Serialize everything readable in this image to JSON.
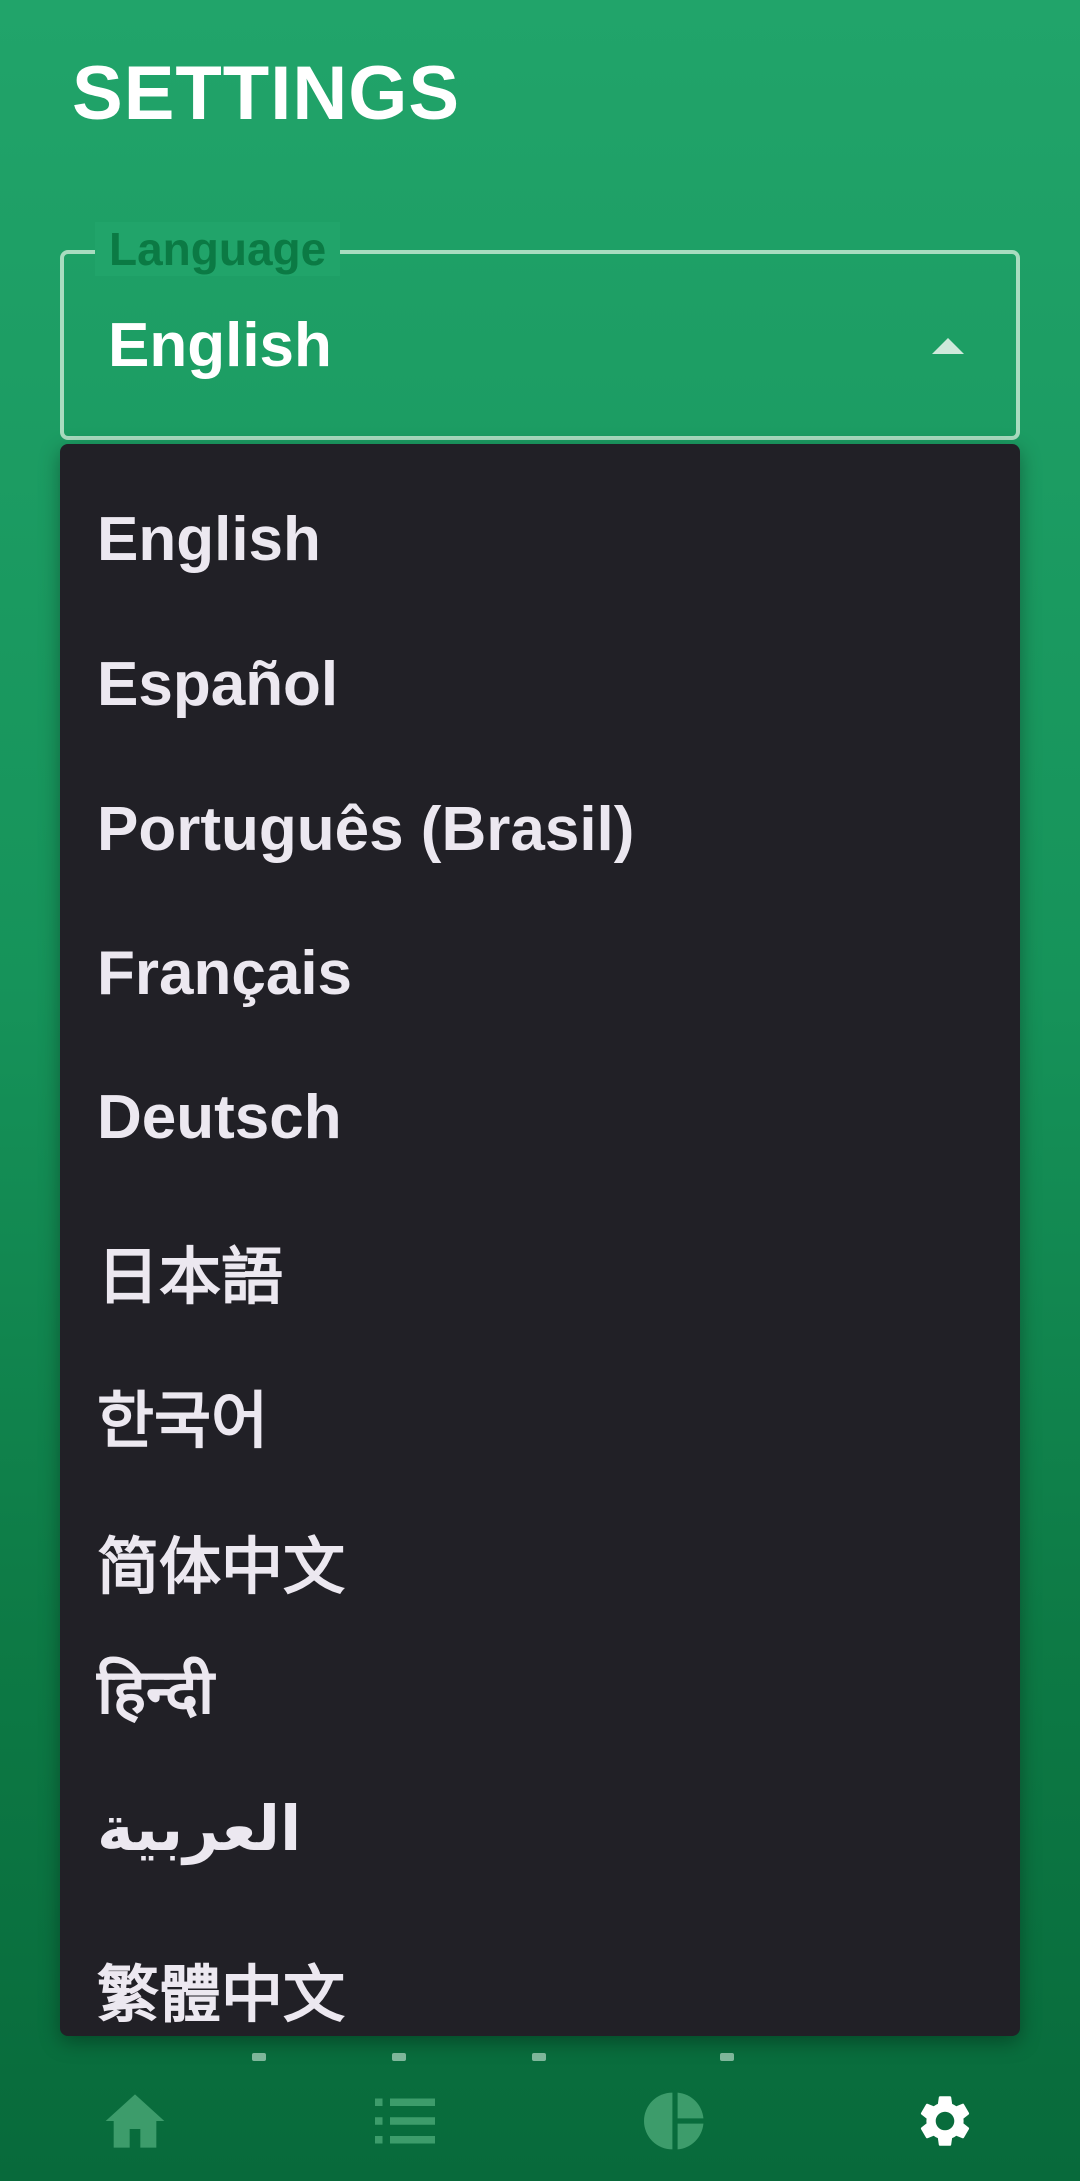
{
  "header": {
    "title": "SETTINGS"
  },
  "language_field": {
    "label": "Language",
    "selected": "English"
  },
  "dropdown": {
    "options": [
      "English",
      "Español",
      "Português (Brasil)",
      "Français",
      "Deutsch",
      "日本語",
      "한국어",
      "简体中文",
      "हिन्दी",
      "العربية",
      "繁體中文"
    ]
  },
  "bottom_nav": {
    "items": [
      "home-icon",
      "list-icon",
      "pie-chart-icon",
      "gear-icon"
    ],
    "active": "gear-icon"
  },
  "colors": {
    "background_top": "#21a46a",
    "background_bottom": "#086a3b",
    "dropdown_bg": "#212026",
    "option_text": "#ece8f0",
    "legend_text": "#0b7a44",
    "nav_inactive": "#3d9c6b",
    "nav_active": "#ffffff"
  }
}
